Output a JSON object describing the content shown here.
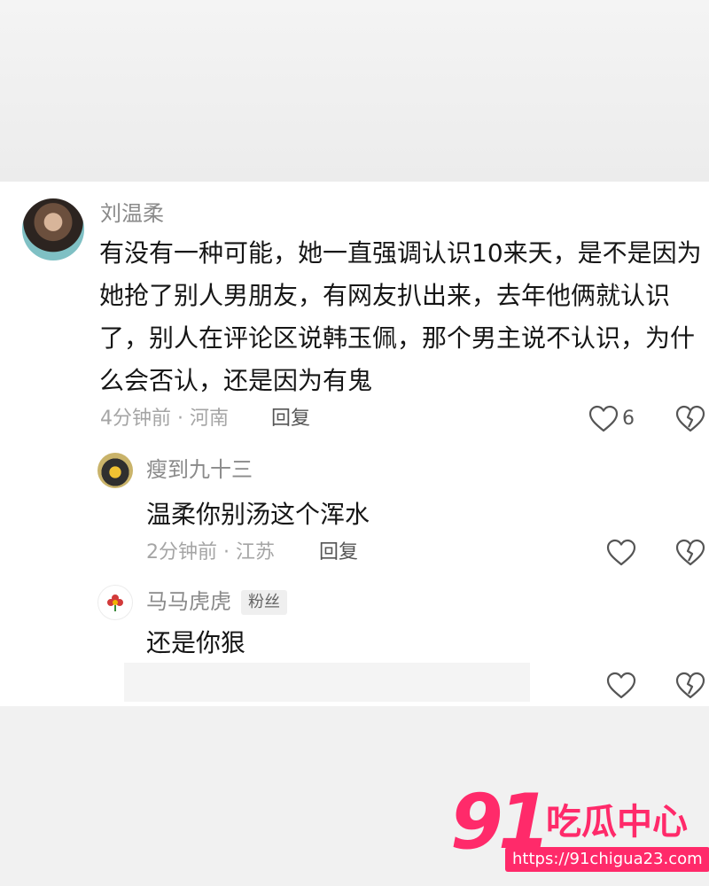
{
  "comments": [
    {
      "author": "刘温柔",
      "lines": [
        "有没有一种可能，她一直强调认识10来天，是不是因为",
        "她抢了别人男朋友，有网友扒出来，去年他俩就认识",
        "了，别人在评论区说韩玉佩，那个男主说不认识，为什",
        "么会否认，还是因为有鬼"
      ],
      "meta": "4分钟前 · 河南",
      "reply_label": "回复",
      "likes": "6"
    }
  ],
  "replies": [
    {
      "author": "瘦到九十三",
      "text": "温柔你别汤这个浑水",
      "meta": "2分钟前 · 江苏",
      "reply_label": "回复"
    },
    {
      "author": "马马虎虎",
      "badge": "粉丝",
      "text": "还是你狠"
    }
  ],
  "watermark": {
    "number": "91",
    "text": "吃瓜中心",
    "url": "https://91chigua23.com"
  },
  "icons": {
    "like": "heart-outline-icon",
    "dislike": "broken-heart-icon",
    "accent": "#ff2a6a"
  }
}
